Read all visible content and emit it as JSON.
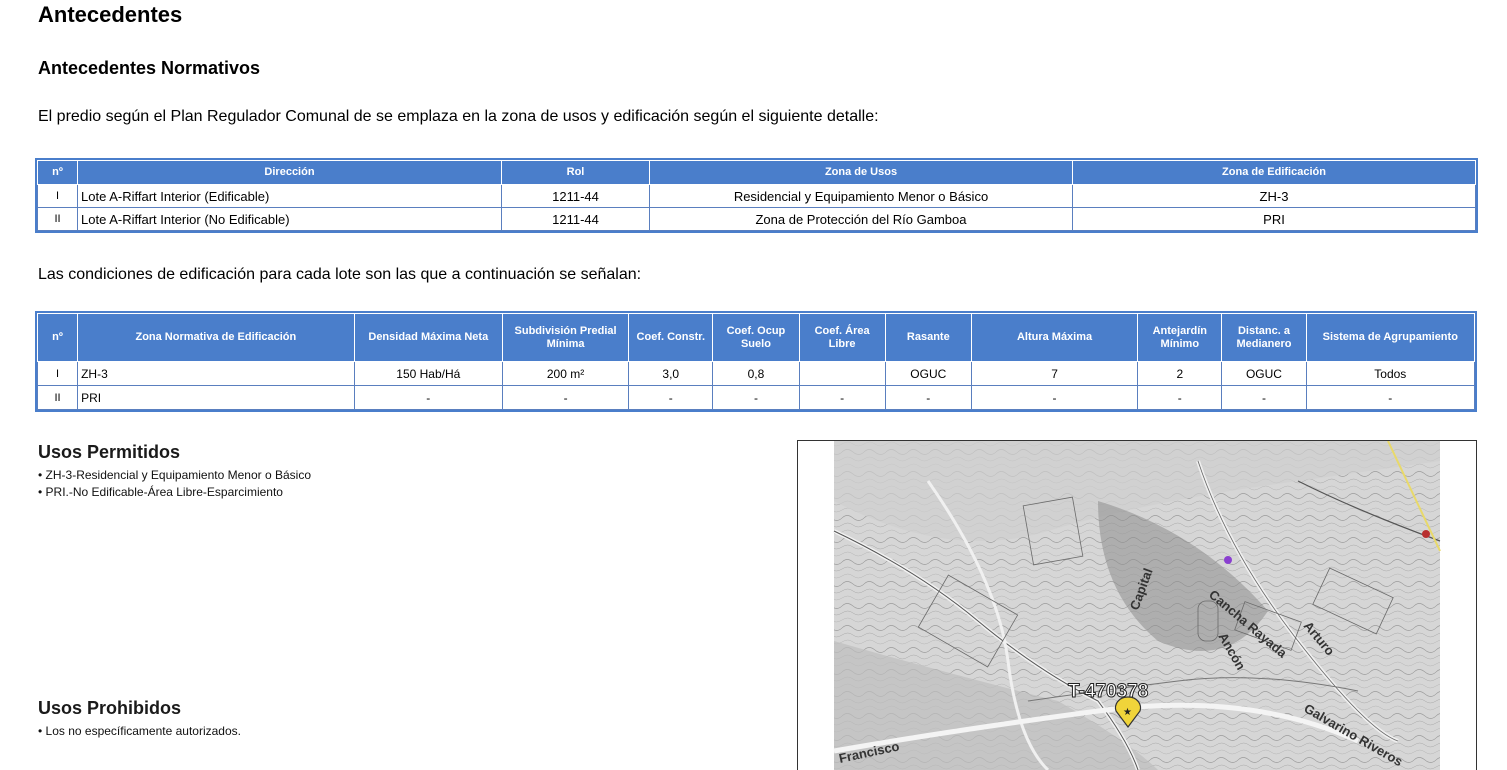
{
  "heading": "Antecedentes",
  "subheading": "Antecedentes Normativos",
  "intro": "El predio según el Plan Regulador Comunal de  se emplaza en la zona de usos y edificación según el siguiente detalle:",
  "table1": {
    "headers": [
      "nº",
      "Dirección",
      "Rol",
      "Zona de Usos",
      "Zona de Edificación"
    ],
    "rows": [
      [
        "I",
        "Lote A-Riffart Interior (Edificable)",
        "1211-44",
        "Residencial y Equipamiento Menor o Básico",
        "ZH-3"
      ],
      [
        "II",
        "Lote A-Riffart Interior (No Edificable)",
        "1211-44",
        "Zona de Protección del Río Gamboa",
        "PRI"
      ]
    ]
  },
  "conditions_text": "Las condiciones de edificación para cada lote son las que a continuación se señalan:",
  "table2": {
    "headers": [
      "nº",
      "Zona Normativa de Edificación",
      "Densidad Máxima Neta",
      "Subdivisión Predial Mínima",
      "Coef. Constr.",
      "Coef. Ocup Suelo",
      "Coef. Área Libre",
      "Rasante",
      "Altura Máxima",
      "Antejardín Mínimo",
      "Distanc. a Medianero",
      "Sistema de Agrupamiento"
    ],
    "rows": [
      [
        "I",
        "ZH-3",
        "150  Hab/Há",
        "200  m²",
        "3,0",
        "0,8",
        "",
        "OGUC",
        "7",
        "2",
        "OGUC",
        "Todos"
      ],
      [
        "II",
        "PRI",
        "-",
        "-",
        "-",
        "-",
        "-",
        "-",
        "-",
        "-",
        "-",
        "-"
      ]
    ]
  },
  "usos_permitidos": {
    "title": "Usos Permitidos",
    "items": [
      "• ZH-3-Residencial y Equipamiento Menor o Básico",
      "• PRI.-No Edificable-Área Libre-Esparcimiento"
    ]
  },
  "usos_prohibidos": {
    "title": "Usos Prohibidos",
    "items": [
      "• Los no específicamente autorizados."
    ]
  },
  "map": {
    "marker_label": "T-470378",
    "street_labels": [
      "Capital",
      "Cancha Rayada",
      "Arturo",
      "Ancón",
      "Galvarino Riveros",
      "Francisco"
    ]
  }
}
